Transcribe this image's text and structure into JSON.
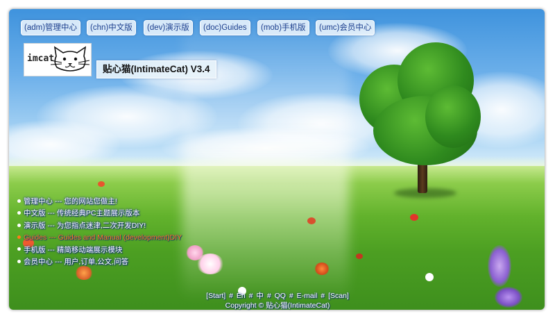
{
  "nav": {
    "items": [
      {
        "label": "(adm)管理中心"
      },
      {
        "label": "(chn)中文版"
      },
      {
        "label": "(dev)演示版"
      },
      {
        "label": "(doc)Guides"
      },
      {
        "label": "(mob)手机版"
      },
      {
        "label": "(umc)会员中心"
      }
    ]
  },
  "logo": {
    "text": "imcat",
    "icon": "cat-face-icon"
  },
  "site_title": "贴心猫(IntimateCat) V3.4",
  "menu": {
    "items": [
      {
        "label": "管理中心 --- 您的网站您做主!"
      },
      {
        "label": "中文版 --- 传统经典PC主题展示版本"
      },
      {
        "label": "演示版 --- 为您指点迷津,二次开发DIY!"
      },
      {
        "label": "Guides --- Guides and Manual (development)DIY"
      },
      {
        "label": "手机版 --- 精简移动端展示模块"
      },
      {
        "label": "会员中心 --- 用户,订单,公文,问答"
      }
    ]
  },
  "footer": {
    "links": [
      "[Start]",
      "En",
      "中",
      "QQ",
      "E-mail",
      "[Scan]"
    ],
    "separator": "#",
    "copyright": "Copyright © 贴心猫(IntimateCat)"
  },
  "colors": {
    "nav_text": "#1a3d8c",
    "menu_text": "#ffffff",
    "menu_highlight": "#ff7a1a",
    "sky": "#6db0ea",
    "grass": "#62b22c"
  }
}
